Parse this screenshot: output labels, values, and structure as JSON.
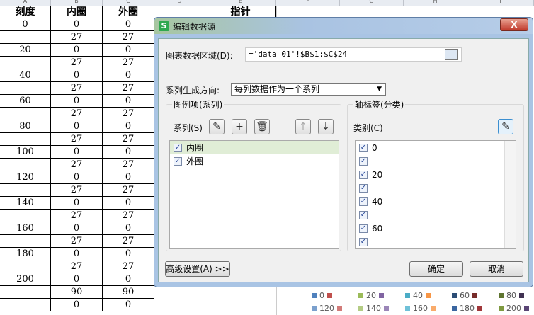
{
  "sheet": {
    "columns": [
      "A",
      "B",
      "C",
      "D",
      "E",
      "F",
      "G",
      "H",
      "I"
    ],
    "headers": [
      "刻度",
      "内圈",
      "外圈",
      "",
      "指针"
    ],
    "scale": [
      "0",
      "",
      "20",
      "",
      "40",
      "",
      "60",
      "",
      "80",
      "",
      "100",
      "",
      "120",
      "",
      "140",
      "",
      "160",
      "",
      "180",
      "",
      "200",
      "",
      ""
    ],
    "inner": [
      "0",
      "27",
      "0",
      "27",
      "0",
      "27",
      "0",
      "27",
      "0",
      "27",
      "0",
      "27",
      "0",
      "27",
      "0",
      "27",
      "0",
      "27",
      "0",
      "27",
      "0",
      "90",
      "0"
    ],
    "outer": [
      "0",
      "27",
      "0",
      "27",
      "0",
      "27",
      "0",
      "27",
      "0",
      "27",
      "0",
      "27",
      "0",
      "27",
      "0",
      "27",
      "0",
      "27",
      "0",
      "27",
      "0",
      "90",
      "0"
    ]
  },
  "legend": {
    "row1": [
      {
        "label": "0",
        "color": "#4f81bd"
      },
      {
        "label": "",
        "color": "#c0504d"
      },
      {
        "label": "20",
        "color": "#9bbb59"
      },
      {
        "label": "",
        "color": "#8064a2"
      },
      {
        "label": "40",
        "color": "#4bacc6"
      },
      {
        "label": "",
        "color": "#f79646"
      },
      {
        "label": "60",
        "color": "#2c4d75"
      },
      {
        "label": "",
        "color": "#772c2a"
      },
      {
        "label": "80",
        "color": "#5f7530"
      },
      {
        "label": "",
        "color": "#403152"
      }
    ],
    "row2": [
      {
        "label": "120",
        "color": "#7ba0cd"
      },
      {
        "label": "",
        "color": "#d27b79"
      },
      {
        "label": "140",
        "color": "#b4cc84"
      },
      {
        "label": "",
        "color": "#9b86b8"
      },
      {
        "label": "160",
        "color": "#6fc1d8"
      },
      {
        "label": "",
        "color": "#f9ab6b"
      },
      {
        "label": "180",
        "color": "#3a66a0"
      },
      {
        "label": "",
        "color": "#a0373a"
      },
      {
        "label": "200",
        "color": "#7f9a40"
      },
      {
        "label": "",
        "color": "#5a4575"
      }
    ]
  },
  "dialog": {
    "logo": "S",
    "title": "编辑数据源",
    "close": "X",
    "range_label": "图表数据区域(D):",
    "range_value": "='data 01'!$B$1:$C$24",
    "direction_label": "系列生成方向:",
    "direction_value": "每列数据作为一个系列",
    "legend_group": "图例项(系列)",
    "series_label": "系列(S)",
    "series": [
      {
        "label": "内圈",
        "checked": true
      },
      {
        "label": "外圈",
        "checked": true
      }
    ],
    "axis_group": "轴标签(分类)",
    "category_label": "类别(C)",
    "categories": [
      "0",
      "",
      "20",
      "",
      "40",
      "",
      "60",
      ""
    ],
    "advanced": "高级设置(A) >>",
    "ok": "确定",
    "cancel": "取消"
  }
}
